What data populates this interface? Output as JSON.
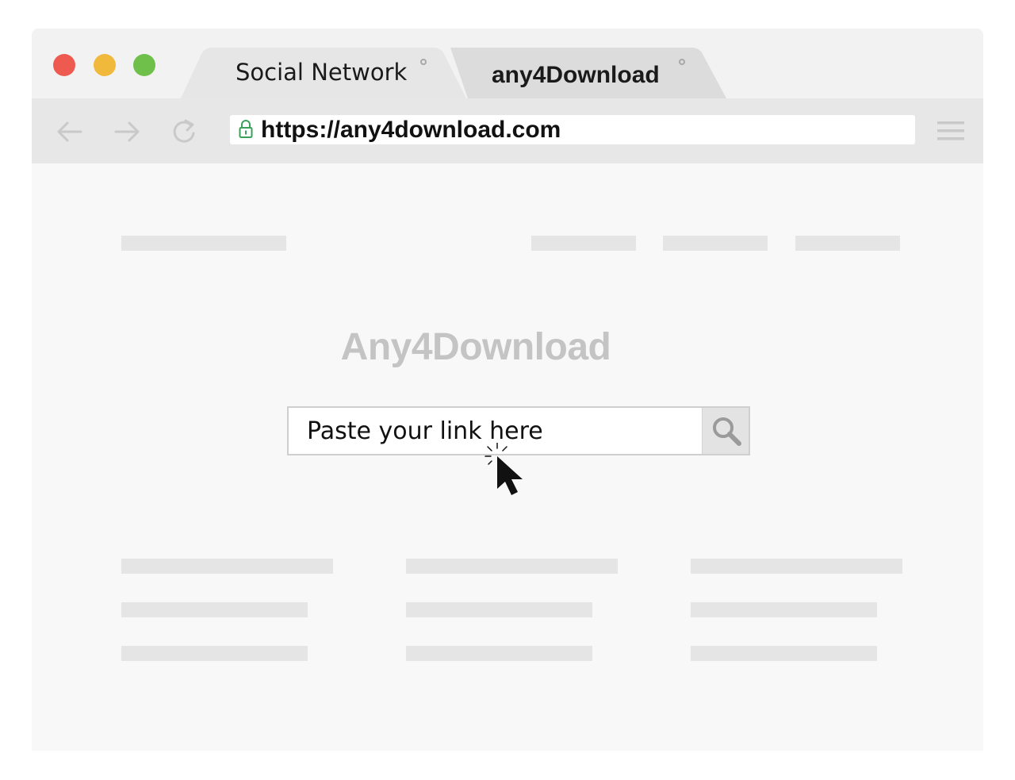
{
  "colors": {
    "close": "#ee5a4f",
    "minimize": "#f1b93c",
    "maximize": "#6fc04a",
    "lock": "#3aa05a",
    "brand_text": "#c4c4c4"
  },
  "tabs": [
    {
      "label": "Social Network",
      "active": false
    },
    {
      "label": "any4Download",
      "active": true
    }
  ],
  "toolbar": {
    "url": "https://any4download.com",
    "icons": [
      "back-arrow-icon",
      "forward-arrow-icon",
      "reload-icon",
      "lock-icon",
      "hamburger-menu-icon"
    ]
  },
  "main": {
    "brand_title": "Any4Download",
    "search": {
      "placeholder": "Paste your link here",
      "button_icon": "search-icon"
    }
  }
}
